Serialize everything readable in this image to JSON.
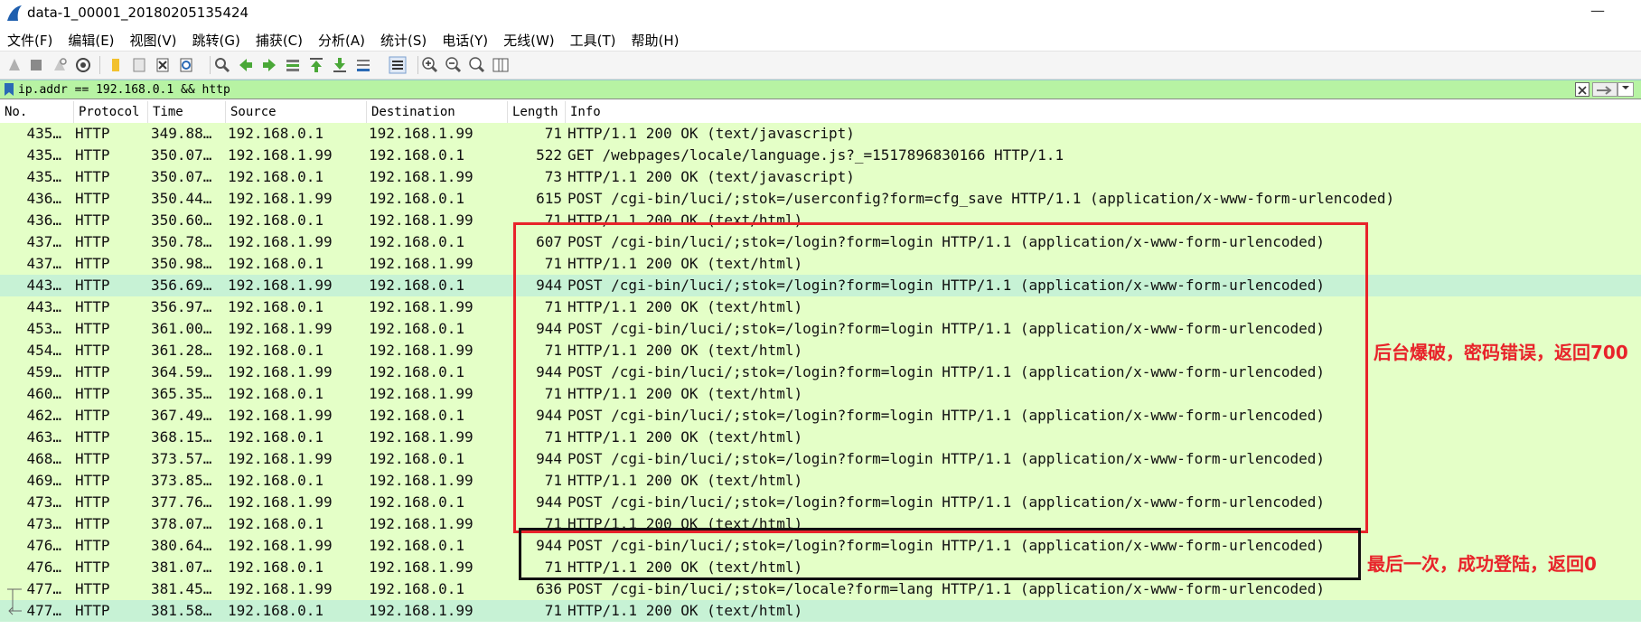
{
  "window": {
    "title": "data-1_00001_20180205135424",
    "minimize_glyph": "—"
  },
  "menu": [
    "文件(F)",
    "编辑(E)",
    "视图(V)",
    "跳转(G)",
    "捕获(C)",
    "分析(A)",
    "统计(S)",
    "电话(Y)",
    "无线(W)",
    "工具(T)",
    "帮助(H)"
  ],
  "filter": {
    "value": "ip.addr == 192.168.0.1 && http",
    "background": "#b7f3a3"
  },
  "columns": [
    "No.",
    "Protocol",
    "Time",
    "Source",
    "Destination",
    "Length",
    "Info"
  ],
  "colors": {
    "row_http": "#e4ffc7",
    "row_selected": "#c7f2d5",
    "annotation": "#e8232a"
  },
  "rows": [
    {
      "no": "435…",
      "proto": "HTTP",
      "time": "349.88…",
      "src": "192.168.0.1",
      "dst": "192.168.1.99",
      "len": "71",
      "info": "HTTP/1.1 200 OK  (text/javascript)"
    },
    {
      "no": "435…",
      "proto": "HTTP",
      "time": "350.07…",
      "src": "192.168.1.99",
      "dst": "192.168.0.1",
      "len": "522",
      "info": "GET /webpages/locale/language.js?_=1517896830166 HTTP/1.1"
    },
    {
      "no": "435…",
      "proto": "HTTP",
      "time": "350.07…",
      "src": "192.168.0.1",
      "dst": "192.168.1.99",
      "len": "73",
      "info": "HTTP/1.1 200 OK  (text/javascript)"
    },
    {
      "no": "436…",
      "proto": "HTTP",
      "time": "350.44…",
      "src": "192.168.1.99",
      "dst": "192.168.0.1",
      "len": "615",
      "info": "POST /cgi-bin/luci/;stok=/userconfig?form=cfg_save HTTP/1.1  (application/x-www-form-urlencoded)"
    },
    {
      "no": "436…",
      "proto": "HTTP",
      "time": "350.60…",
      "src": "192.168.0.1",
      "dst": "192.168.1.99",
      "len": "71",
      "info": "HTTP/1.1 200 OK  (text/html)"
    },
    {
      "no": "437…",
      "proto": "HTTP",
      "time": "350.78…",
      "src": "192.168.1.99",
      "dst": "192.168.0.1",
      "len": "607",
      "info": "POST /cgi-bin/luci/;stok=/login?form=login HTTP/1.1  (application/x-www-form-urlencoded)"
    },
    {
      "no": "437…",
      "proto": "HTTP",
      "time": "350.98…",
      "src": "192.168.0.1",
      "dst": "192.168.1.99",
      "len": "71",
      "info": "HTTP/1.1 200 OK  (text/html)"
    },
    {
      "no": "443…",
      "proto": "HTTP",
      "time": "356.69…",
      "src": "192.168.1.99",
      "dst": "192.168.0.1",
      "len": "944",
      "info": "POST /cgi-bin/luci/;stok=/login?form=login HTTP/1.1  (application/x-www-form-urlencoded)",
      "selected": true
    },
    {
      "no": "443…",
      "proto": "HTTP",
      "time": "356.97…",
      "src": "192.168.0.1",
      "dst": "192.168.1.99",
      "len": "71",
      "info": "HTTP/1.1 200 OK  (text/html)"
    },
    {
      "no": "453…",
      "proto": "HTTP",
      "time": "361.00…",
      "src": "192.168.1.99",
      "dst": "192.168.0.1",
      "len": "944",
      "info": "POST /cgi-bin/luci/;stok=/login?form=login HTTP/1.1  (application/x-www-form-urlencoded)"
    },
    {
      "no": "454…",
      "proto": "HTTP",
      "time": "361.28…",
      "src": "192.168.0.1",
      "dst": "192.168.1.99",
      "len": "71",
      "info": "HTTP/1.1 200 OK  (text/html)"
    },
    {
      "no": "459…",
      "proto": "HTTP",
      "time": "364.59…",
      "src": "192.168.1.99",
      "dst": "192.168.0.1",
      "len": "944",
      "info": "POST /cgi-bin/luci/;stok=/login?form=login HTTP/1.1  (application/x-www-form-urlencoded)"
    },
    {
      "no": "460…",
      "proto": "HTTP",
      "time": "365.35…",
      "src": "192.168.0.1",
      "dst": "192.168.1.99",
      "len": "71",
      "info": "HTTP/1.1 200 OK  (text/html)"
    },
    {
      "no": "462…",
      "proto": "HTTP",
      "time": "367.49…",
      "src": "192.168.1.99",
      "dst": "192.168.0.1",
      "len": "944",
      "info": "POST /cgi-bin/luci/;stok=/login?form=login HTTP/1.1  (application/x-www-form-urlencoded)"
    },
    {
      "no": "463…",
      "proto": "HTTP",
      "time": "368.15…",
      "src": "192.168.0.1",
      "dst": "192.168.1.99",
      "len": "71",
      "info": "HTTP/1.1 200 OK  (text/html)"
    },
    {
      "no": "468…",
      "proto": "HTTP",
      "time": "373.57…",
      "src": "192.168.1.99",
      "dst": "192.168.0.1",
      "len": "944",
      "info": "POST /cgi-bin/luci/;stok=/login?form=login HTTP/1.1  (application/x-www-form-urlencoded)"
    },
    {
      "no": "469…",
      "proto": "HTTP",
      "time": "373.85…",
      "src": "192.168.0.1",
      "dst": "192.168.1.99",
      "len": "71",
      "info": "HTTP/1.1 200 OK  (text/html)"
    },
    {
      "no": "473…",
      "proto": "HTTP",
      "time": "377.76…",
      "src": "192.168.1.99",
      "dst": "192.168.0.1",
      "len": "944",
      "info": "POST /cgi-bin/luci/;stok=/login?form=login HTTP/1.1  (application/x-www-form-urlencoded)"
    },
    {
      "no": "473…",
      "proto": "HTTP",
      "time": "378.07…",
      "src": "192.168.0.1",
      "dst": "192.168.1.99",
      "len": "71",
      "info": "HTTP/1.1 200 OK  (text/html)"
    },
    {
      "no": "476…",
      "proto": "HTTP",
      "time": "380.64…",
      "src": "192.168.1.99",
      "dst": "192.168.0.1",
      "len": "944",
      "info": "POST /cgi-bin/luci/;stok=/login?form=login HTTP/1.1  (application/x-www-form-urlencoded)"
    },
    {
      "no": "476…",
      "proto": "HTTP",
      "time": "381.07…",
      "src": "192.168.0.1",
      "dst": "192.168.1.99",
      "len": "71",
      "info": "HTTP/1.1 200 OK  (text/html)"
    },
    {
      "no": "477…",
      "proto": "HTTP",
      "time": "381.45…",
      "src": "192.168.1.99",
      "dst": "192.168.0.1",
      "len": "636",
      "info": "POST /cgi-bin/luci/;stok=/locale?form=lang HTTP/1.1  (application/x-www-form-urlencoded)",
      "mark": "request"
    },
    {
      "no": "477…",
      "proto": "HTTP",
      "time": "381.58…",
      "src": "192.168.0.1",
      "dst": "192.168.1.99",
      "len": "71",
      "info": "HTTP/1.1 200 OK  (text/html)",
      "selected": true,
      "mark": "response"
    }
  ],
  "annotations": {
    "brute_force": "后台爆破，密码错误，返回700",
    "last_success": "最后一次，成功登陆，返回0"
  }
}
